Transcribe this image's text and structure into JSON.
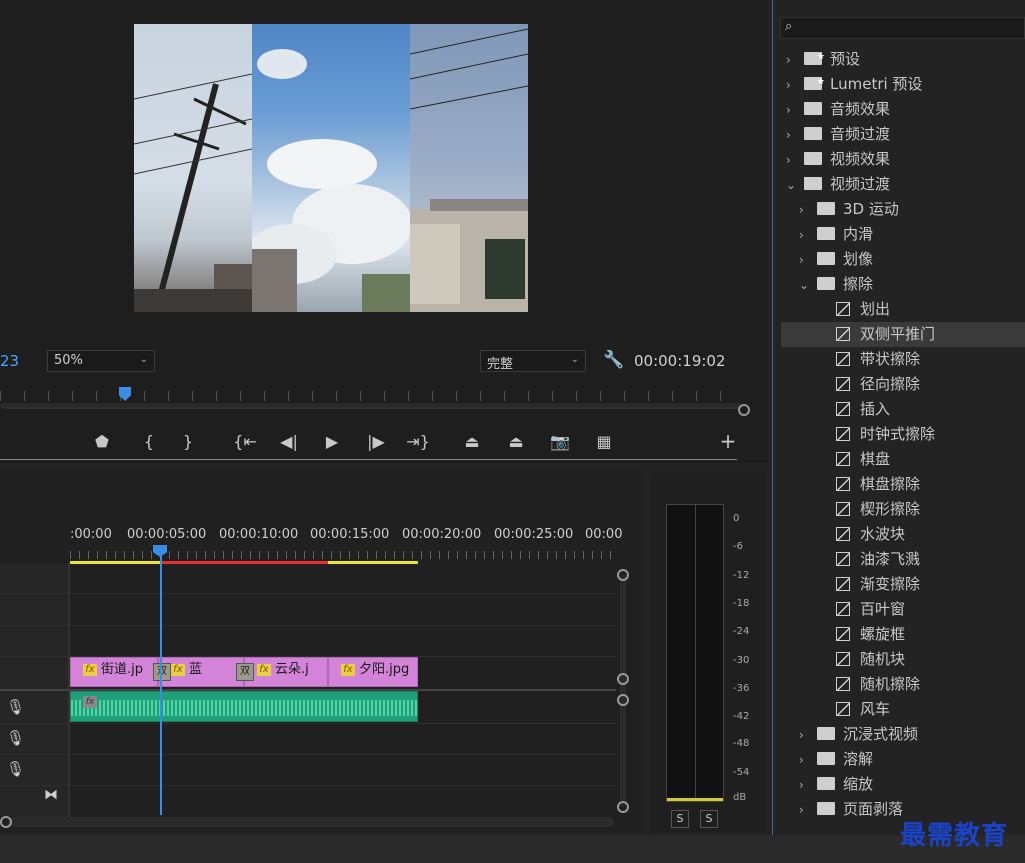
{
  "monitor": {
    "left_timecode": "23",
    "zoom": "50%",
    "quality": "完整",
    "timecode": "00:00:19:02",
    "transport": [
      "marker",
      "in",
      "out",
      "go-in",
      "step-back",
      "play",
      "step-forward",
      "go-out",
      "lift",
      "extract",
      "export-frame",
      "comparison",
      "add"
    ]
  },
  "timeline": {
    "ruler_labels": [
      ":00:00",
      "00:00:05:00",
      "00:00:10:00",
      "00:00:15:00",
      "00:00:20:00",
      "00:00:25:00",
      "00:00"
    ],
    "clips": [
      {
        "label": "街道.jp"
      },
      {
        "label": "蓝"
      },
      {
        "label": "云朵.j"
      },
      {
        "label": "夕阳.jpg"
      }
    ],
    "transitions": [
      "双",
      "双"
    ],
    "fx": "fx"
  },
  "meter": {
    "db_labels": [
      "0",
      "-6",
      "-12",
      "-18",
      "-24",
      "-30",
      "-36",
      "-42",
      "-48",
      "-54",
      "dB"
    ],
    "solo": [
      "S",
      "S"
    ]
  },
  "effects": {
    "items": [
      {
        "label": "预设",
        "level": 0,
        "type": "folder-star",
        "expanded": false
      },
      {
        "label": "Lumetri 预设",
        "level": 0,
        "type": "folder-star",
        "expanded": false
      },
      {
        "label": "音频效果",
        "level": 0,
        "type": "folder",
        "expanded": false
      },
      {
        "label": "音频过渡",
        "level": 0,
        "type": "folder",
        "expanded": false
      },
      {
        "label": "视频效果",
        "level": 0,
        "type": "folder",
        "expanded": false
      },
      {
        "label": "视频过渡",
        "level": 0,
        "type": "folder",
        "expanded": true
      },
      {
        "label": "3D 运动",
        "level": 1,
        "type": "folder",
        "expanded": false
      },
      {
        "label": "内滑",
        "level": 1,
        "type": "folder",
        "expanded": false
      },
      {
        "label": "划像",
        "level": 1,
        "type": "folder",
        "expanded": false
      },
      {
        "label": "擦除",
        "level": 1,
        "type": "folder",
        "expanded": true
      },
      {
        "label": "划出",
        "level": 2,
        "type": "transition"
      },
      {
        "label": "双侧平推门",
        "level": 2,
        "type": "transition",
        "selected": true
      },
      {
        "label": "带状擦除",
        "level": 2,
        "type": "transition"
      },
      {
        "label": "径向擦除",
        "level": 2,
        "type": "transition"
      },
      {
        "label": "插入",
        "level": 2,
        "type": "transition"
      },
      {
        "label": "时钟式擦除",
        "level": 2,
        "type": "transition"
      },
      {
        "label": "棋盘",
        "level": 2,
        "type": "transition"
      },
      {
        "label": "棋盘擦除",
        "level": 2,
        "type": "transition"
      },
      {
        "label": "楔形擦除",
        "level": 2,
        "type": "transition"
      },
      {
        "label": "水波块",
        "level": 2,
        "type": "transition"
      },
      {
        "label": "油漆飞溅",
        "level": 2,
        "type": "transition"
      },
      {
        "label": "渐变擦除",
        "level": 2,
        "type": "transition"
      },
      {
        "label": "百叶窗",
        "level": 2,
        "type": "transition"
      },
      {
        "label": "螺旋框",
        "level": 2,
        "type": "transition"
      },
      {
        "label": "随机块",
        "level": 2,
        "type": "transition"
      },
      {
        "label": "随机擦除",
        "level": 2,
        "type": "transition"
      },
      {
        "label": "风车",
        "level": 2,
        "type": "transition"
      },
      {
        "label": "沉浸式视频",
        "level": 1,
        "type": "folder",
        "expanded": false
      },
      {
        "label": "溶解",
        "level": 1,
        "type": "folder",
        "expanded": false
      },
      {
        "label": "缩放",
        "level": 1,
        "type": "folder",
        "expanded": false
      },
      {
        "label": "页面剥落",
        "level": 1,
        "type": "folder",
        "expanded": false
      }
    ]
  },
  "watermark": "最需教育"
}
